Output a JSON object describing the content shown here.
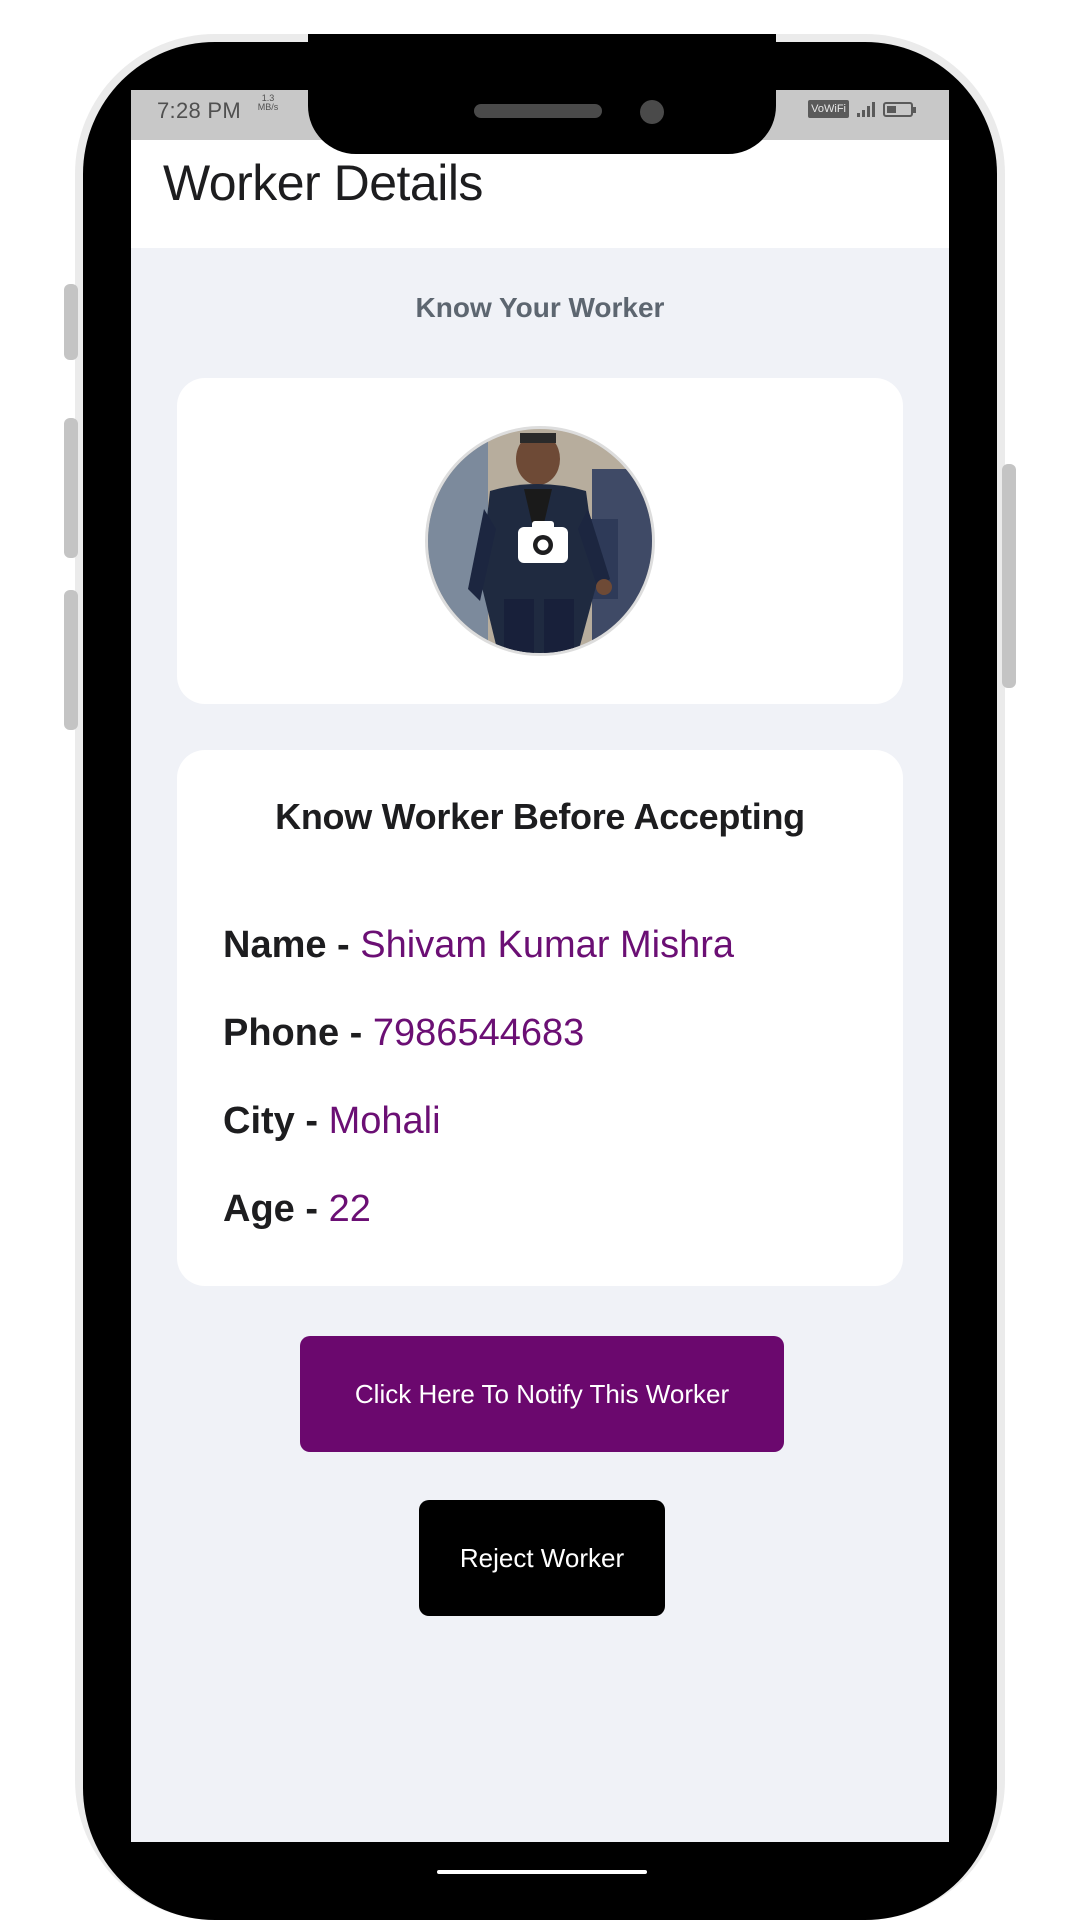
{
  "status_bar": {
    "time": "7:28 PM",
    "speed": "1.3 MB/s",
    "network_badge": "VoWiFi",
    "icons": [
      "signal-icon",
      "battery-icon"
    ]
  },
  "header": {
    "title": "Worker Details"
  },
  "main": {
    "section_heading": "Know Your Worker",
    "photo_card": {
      "avatar": "worker-photo",
      "camera_icon": "camera-icon"
    },
    "info_card": {
      "heading": "Know Worker Before Accepting",
      "separator": " - ",
      "fields": {
        "name": {
          "label": "Name",
          "value": "Shivam Kumar Mishra"
        },
        "phone": {
          "label": "Phone",
          "value": "7986544683"
        },
        "city": {
          "label": "City",
          "value": "Mohali"
        },
        "age": {
          "label": "Age",
          "value": "22"
        }
      }
    },
    "actions": {
      "notify_label": "Click Here To Notify This Worker",
      "reject_label": "Reject Worker"
    }
  },
  "colors": {
    "accent": "#6b086e",
    "value_text": "#6b0f74",
    "screen_bg": "#f0f2f7",
    "card_bg": "#ffffff",
    "reject_button": "#000000"
  }
}
